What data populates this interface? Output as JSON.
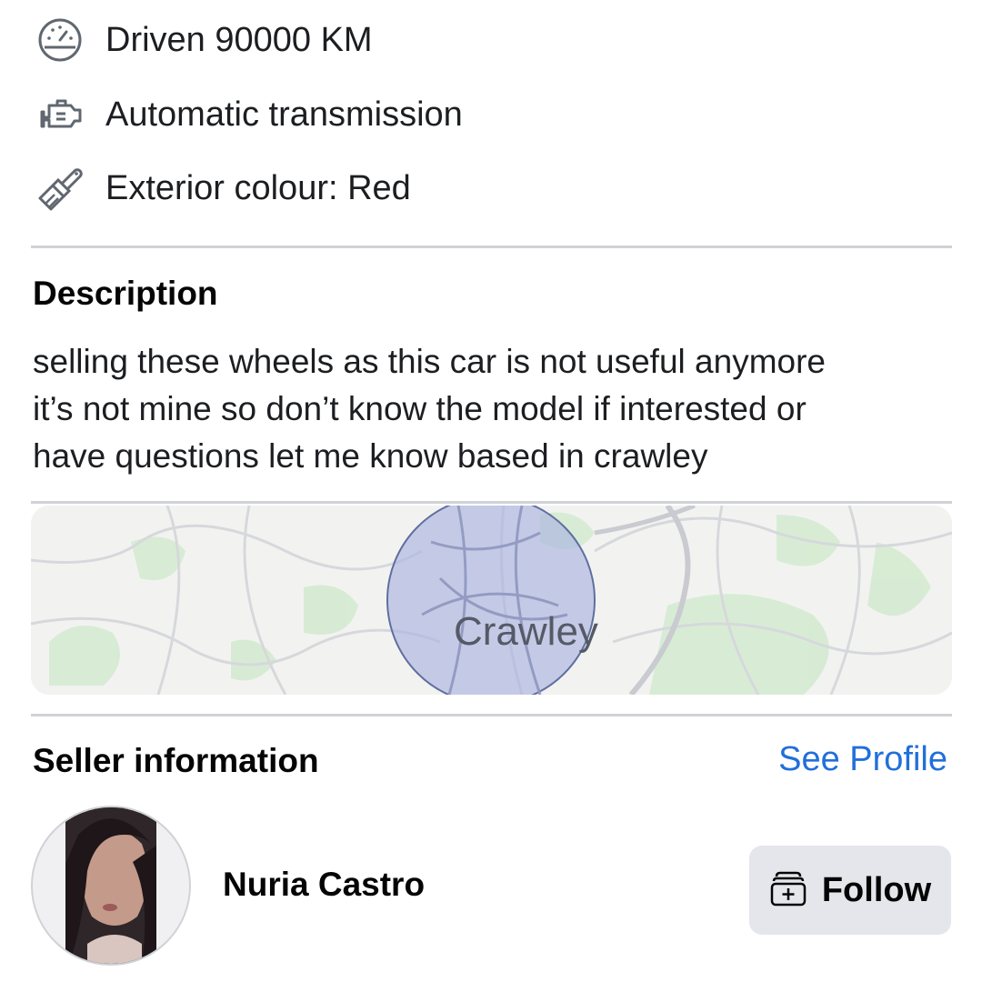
{
  "specs": [
    {
      "icon": "speedometer-icon",
      "text": "Driven 90000 KM"
    },
    {
      "icon": "engine-icon",
      "text": "Automatic transmission"
    },
    {
      "icon": "paintbrush-icon",
      "text": "Exterior colour: Red"
    }
  ],
  "description": {
    "title": "Description",
    "lines": [
      "selling these wheels as this car is not useful anymore",
      "it’s not mine so don’t know the model if interested or",
      "have questions let me know based in crawley"
    ]
  },
  "map": {
    "location_label": "Crawley",
    "radius_fill_color": "#aab4e0",
    "radius_stroke_color": "#5f6f9f"
  },
  "seller": {
    "title": "Seller information",
    "see_profile": "See Profile",
    "name": "Nuria Castro",
    "follow_label": "Follow"
  },
  "colors": {
    "link": "#216fdb",
    "button_bg": "#e4e6eb",
    "divider": "#d0d2d6"
  }
}
